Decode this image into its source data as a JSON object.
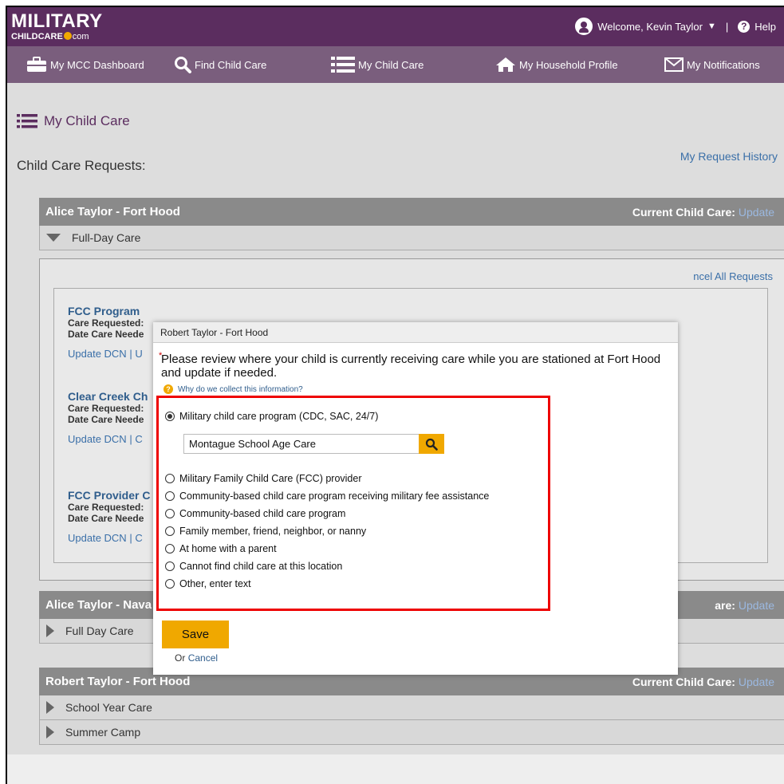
{
  "header": {
    "logo_main": "MILITARY",
    "logo_sub_left": "CHILDCARE",
    "logo_sub_right": "com",
    "welcome": "Welcome, Kevin Taylor",
    "help": "Help"
  },
  "nav": {
    "items": [
      {
        "label": "My MCC Dashboard",
        "icon": "briefcase-icon"
      },
      {
        "label": "Find Child Care",
        "icon": "search-icon"
      },
      {
        "label": "My Child Care",
        "icon": "list-icon"
      },
      {
        "label": "My Household Profile",
        "icon": "home-icon"
      },
      {
        "label": "My Notifications",
        "icon": "envelope-icon"
      }
    ]
  },
  "page": {
    "heading": "My Child Care",
    "requests_title": "Child Care Requests:",
    "history_link": "My Request History"
  },
  "sections": [
    {
      "title": "Alice Taylor - Fort Hood",
      "current_label": "Current Child Care:",
      "current_link": "Update",
      "rows": [
        "Full-Day Care"
      ],
      "cancel_all": "ncel All Requests",
      "cards": [
        {
          "title": "FCC Program",
          "care_requested": "Care Requested:",
          "date_needed": "Date Care Neede",
          "link1": "Update DCN",
          "link2": "U"
        },
        {
          "title": "Clear Creek Ch",
          "care_requested": "Care Requested:",
          "date_needed": "Date Care Neede",
          "link1": "Update DCN",
          "link2": "C"
        },
        {
          "title": "FCC Provider C",
          "care_requested": "Care Requested:",
          "date_needed": "Date Care Neede",
          "link1": "Update DCN",
          "link2": "C"
        }
      ]
    },
    {
      "title": "Alice Taylor - Nava",
      "current_label": "are:",
      "current_link": "Update",
      "rows": [
        "Full Day Care"
      ]
    },
    {
      "title": "Robert Taylor - Fort Hood",
      "current_label": "Current Child Care:",
      "current_link": "Update",
      "rows": [
        "School Year Care",
        "Summer Camp"
      ]
    }
  ],
  "modal": {
    "title": "Robert Taylor - Fort Hood",
    "question": "Please review where your child is currently receiving care while you are stationed at Fort Hood and update if needed.",
    "why_link": "Why do we collect this information?",
    "program_value": "Montague School Age Care",
    "options": [
      {
        "label": "Military child care program (CDC, SAC, 24/7)",
        "selected": true
      },
      {
        "label": "Military Family Child Care (FCC) provider",
        "selected": false
      },
      {
        "label": "Community-based child care program receiving military fee assistance",
        "selected": false
      },
      {
        "label": "Community-based child care program",
        "selected": false
      },
      {
        "label": "Family member, friend, neighbor, or nanny",
        "selected": false
      },
      {
        "label": "At home with a parent",
        "selected": false
      },
      {
        "label": "Cannot find child care at this location",
        "selected": false
      },
      {
        "label": "Other, enter text",
        "selected": false
      }
    ],
    "save_label": "Save",
    "or_text": "Or",
    "cancel_label": "Cancel"
  },
  "colors": {
    "brand_purple": "#5b2d5f",
    "nav_purple": "#7a5e7d",
    "accent_gold": "#f0a800",
    "highlight_red": "#e00000",
    "link_blue": "#3a6fa8"
  }
}
